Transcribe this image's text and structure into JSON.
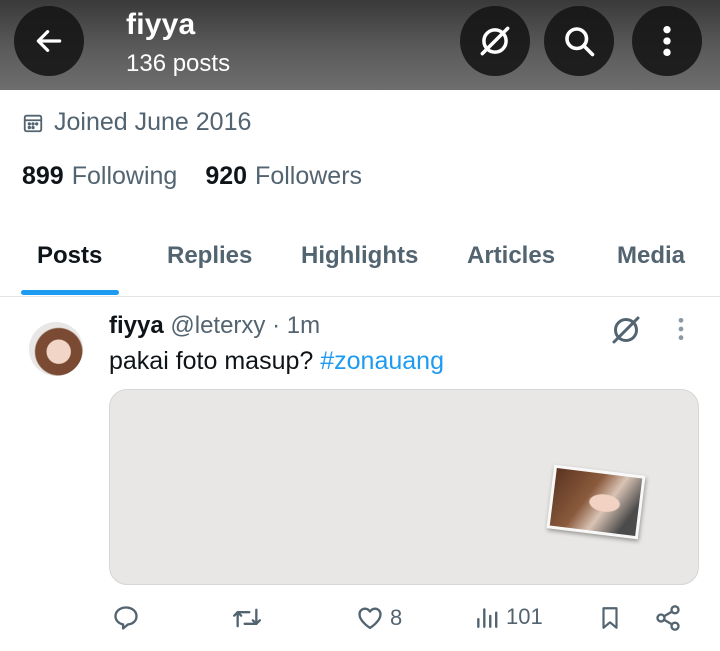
{
  "header": {
    "name": "fiyya",
    "posts_count": "136 posts"
  },
  "profile": {
    "joined": "Joined June 2016",
    "following_count": "899",
    "following_label": "Following",
    "followers_count": "920",
    "followers_label": "Followers"
  },
  "tabs": [
    {
      "label": "Posts",
      "active": true
    },
    {
      "label": "Replies",
      "active": false
    },
    {
      "label": "Highlights",
      "active": false
    },
    {
      "label": "Articles",
      "active": false
    },
    {
      "label": "Media",
      "active": false
    }
  ],
  "post": {
    "author_name": "fiyya",
    "handle": "@leterxy",
    "separator": " · ",
    "time": "1m",
    "text": "pakai foto masup? ",
    "hashtag": "#zonauang",
    "actions": {
      "likes": "8",
      "views": "101"
    }
  },
  "colors": {
    "accent": "#1d9bf0",
    "text_primary": "#0f1419",
    "text_secondary": "#536471"
  },
  "icons": [
    "back-arrow-icon",
    "grok-icon",
    "search-icon",
    "more-vertical-icon",
    "calendar-icon",
    "reply-icon",
    "repost-icon",
    "heart-icon",
    "views-icon",
    "bookmark-icon",
    "share-icon"
  ]
}
